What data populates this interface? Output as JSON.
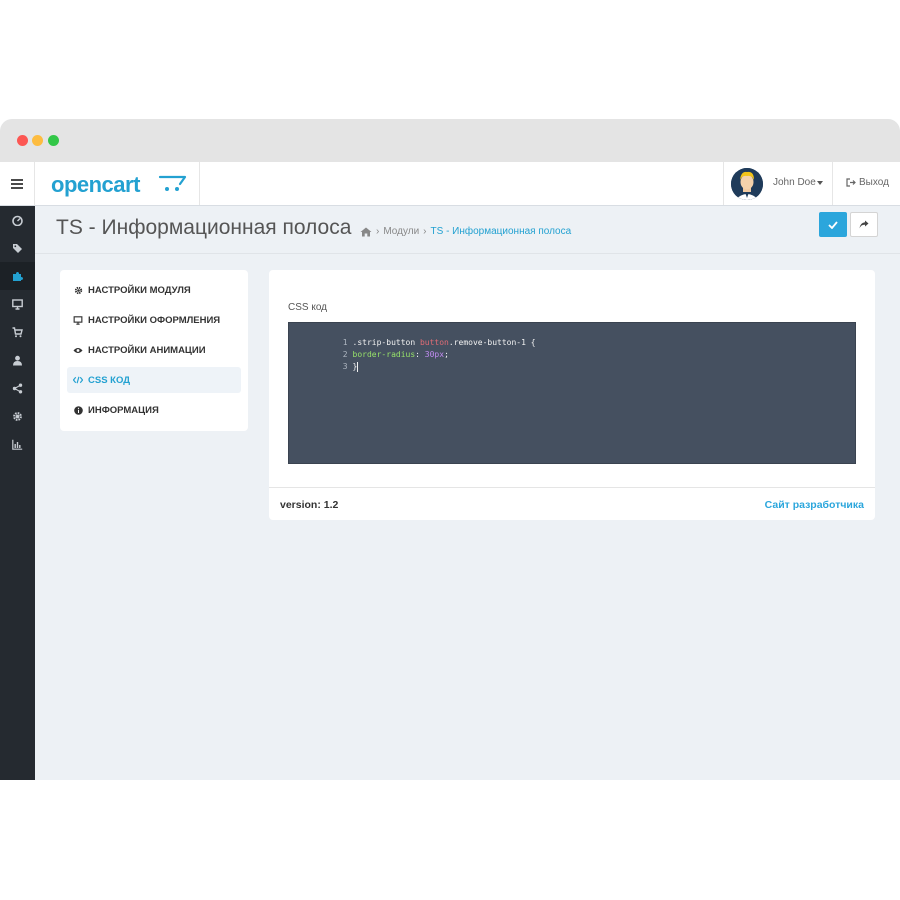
{
  "header": {
    "logo_text": "opencart",
    "user_name": "John Doe",
    "logout_label": "Выход"
  },
  "sidebar": {
    "icons": [
      "dashboard-icon",
      "tag-icon",
      "puzzle-icon",
      "desktop-icon",
      "cart-icon",
      "user-icon",
      "share-icon",
      "gear-icon",
      "chart-icon"
    ],
    "active_index": 2
  },
  "page": {
    "title": "TS - Информационная полоса",
    "breadcrumb": {
      "modules": "Модули",
      "current": "TS - Информационная полоса"
    }
  },
  "nav": {
    "items": [
      {
        "icon": "gear-icon",
        "label": "НАСТРОЙКИ МОДУЛЯ"
      },
      {
        "icon": "desktop-icon",
        "label": "НАСТРОЙКИ ОФОРМЛЕНИЯ"
      },
      {
        "icon": "eye-icon",
        "label": "НАСТРОЙКИ АНИМАЦИИ"
      },
      {
        "icon": "code-icon",
        "label": "CSS КОД"
      },
      {
        "icon": "info-icon",
        "label": "ИНФОРМАЦИЯ"
      }
    ],
    "active_index": 3
  },
  "main": {
    "css_label": "CSS код",
    "code": {
      "line1_num": "1",
      "line1_selector": ".strip-button ",
      "line1_tag": "button",
      "line1_rest": ".remove-button-1 {",
      "line2_num": "2",
      "line2_prop": "border-radius",
      "line2_colon": ": ",
      "line2_value": "30px",
      "line2_semicolon": ";",
      "line3_num": "3",
      "line3_text": "}"
    },
    "version": "version: 1.2",
    "dev_link": "Сайт разработчика"
  },
  "colors": {
    "accent": "#23a1d1",
    "sidebar_bg": "#252a30",
    "editor_bg": "#455060"
  }
}
